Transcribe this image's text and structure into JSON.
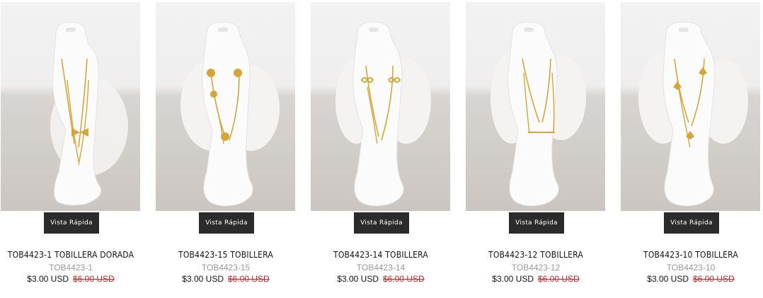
{
  "quick_view_label": "Vista Rápida",
  "products": [
    {
      "title": "TOB4423-1 TOBILLERA DORADA",
      "sku": "TOB4423-1",
      "price": "$3.00 USD",
      "old_price": "$6.00 USD",
      "charm": "bow"
    },
    {
      "title": "TOB4423-15 TOBILLERA",
      "sku": "TOB4423-15",
      "price": "$3.00 USD",
      "old_price": "$6.00 USD",
      "charm": "flower"
    },
    {
      "title": "TOB4423-14 TOBILLERA",
      "sku": "TOB4423-14",
      "price": "$3.00 USD",
      "old_price": "$6.00 USD",
      "charm": "infinity"
    },
    {
      "title": "TOB4423-12 TOBILLERA",
      "sku": "TOB4423-12",
      "price": "$3.00 USD",
      "old_price": "$6.00 USD",
      "charm": "bar"
    },
    {
      "title": "TOB4423-10 TOBILLERA",
      "sku": "TOB4423-10",
      "price": "$3.00 USD",
      "old_price": "$6.00 USD",
      "charm": "leaf"
    }
  ],
  "colors": {
    "quick_view_bg": "#2b2b2b",
    "old_price": "#c62828",
    "sku": "#9a9a9a",
    "gold": "#d4a639"
  }
}
